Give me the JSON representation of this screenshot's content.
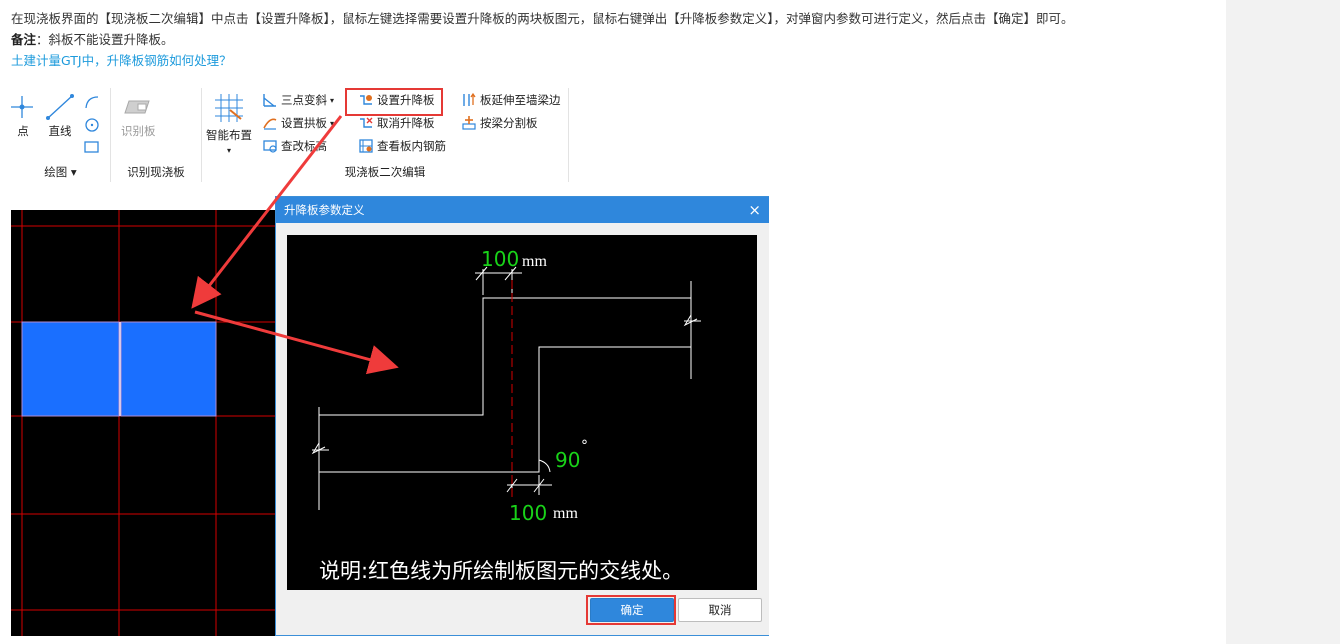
{
  "article": {
    "line1": "在现浇板界面的【现浇板二次编辑】中点击【设置升降板】，鼠标左键选择需要设置升降板的两块板图元，鼠标右键弹出【升降板参数定义】，对弹窗内参数可进行定义，然后点击【确定】即可。",
    "note_label": "备注",
    "note_text": "：斜板不能设置升降板。",
    "link_text": "土建计量GTJ中，升降板钢筋如何处理？"
  },
  "ribbon": {
    "draw_group": {
      "point": "点",
      "line": "直线",
      "label": "绘图"
    },
    "identify_group": {
      "identify_slab": "识别板",
      "label": "识别现浇板"
    },
    "edit_group": {
      "smart_layout": "智能布置",
      "three_point_slope": "三点变斜",
      "set_arch_slab": "设置拱板",
      "edit_elevation": "查改标高",
      "set_lift_slab": "设置升降板",
      "cancel_lift_slab": "取消升降板",
      "view_rebar": "查看板内钢筋",
      "extend_to_wall": "板延伸至墙梁边",
      "split_by_beam": "按梁分割板",
      "label": "现浇板二次编辑"
    }
  },
  "dialog": {
    "title": "升降板参数定义",
    "top_value": "100",
    "top_unit": "mm",
    "angle_value": "90",
    "angle_unit": "°",
    "bottom_value": "100",
    "bottom_unit": "mm",
    "note": "说明:红色线为所绘制板图元的交线处。",
    "ok": "确定",
    "cancel": "取消"
  },
  "colors": {
    "accent": "#2f87dc",
    "highlight": "#e53935",
    "slab": "#1a6fff",
    "grid": "#d40000",
    "dim_green": "#19d319"
  }
}
